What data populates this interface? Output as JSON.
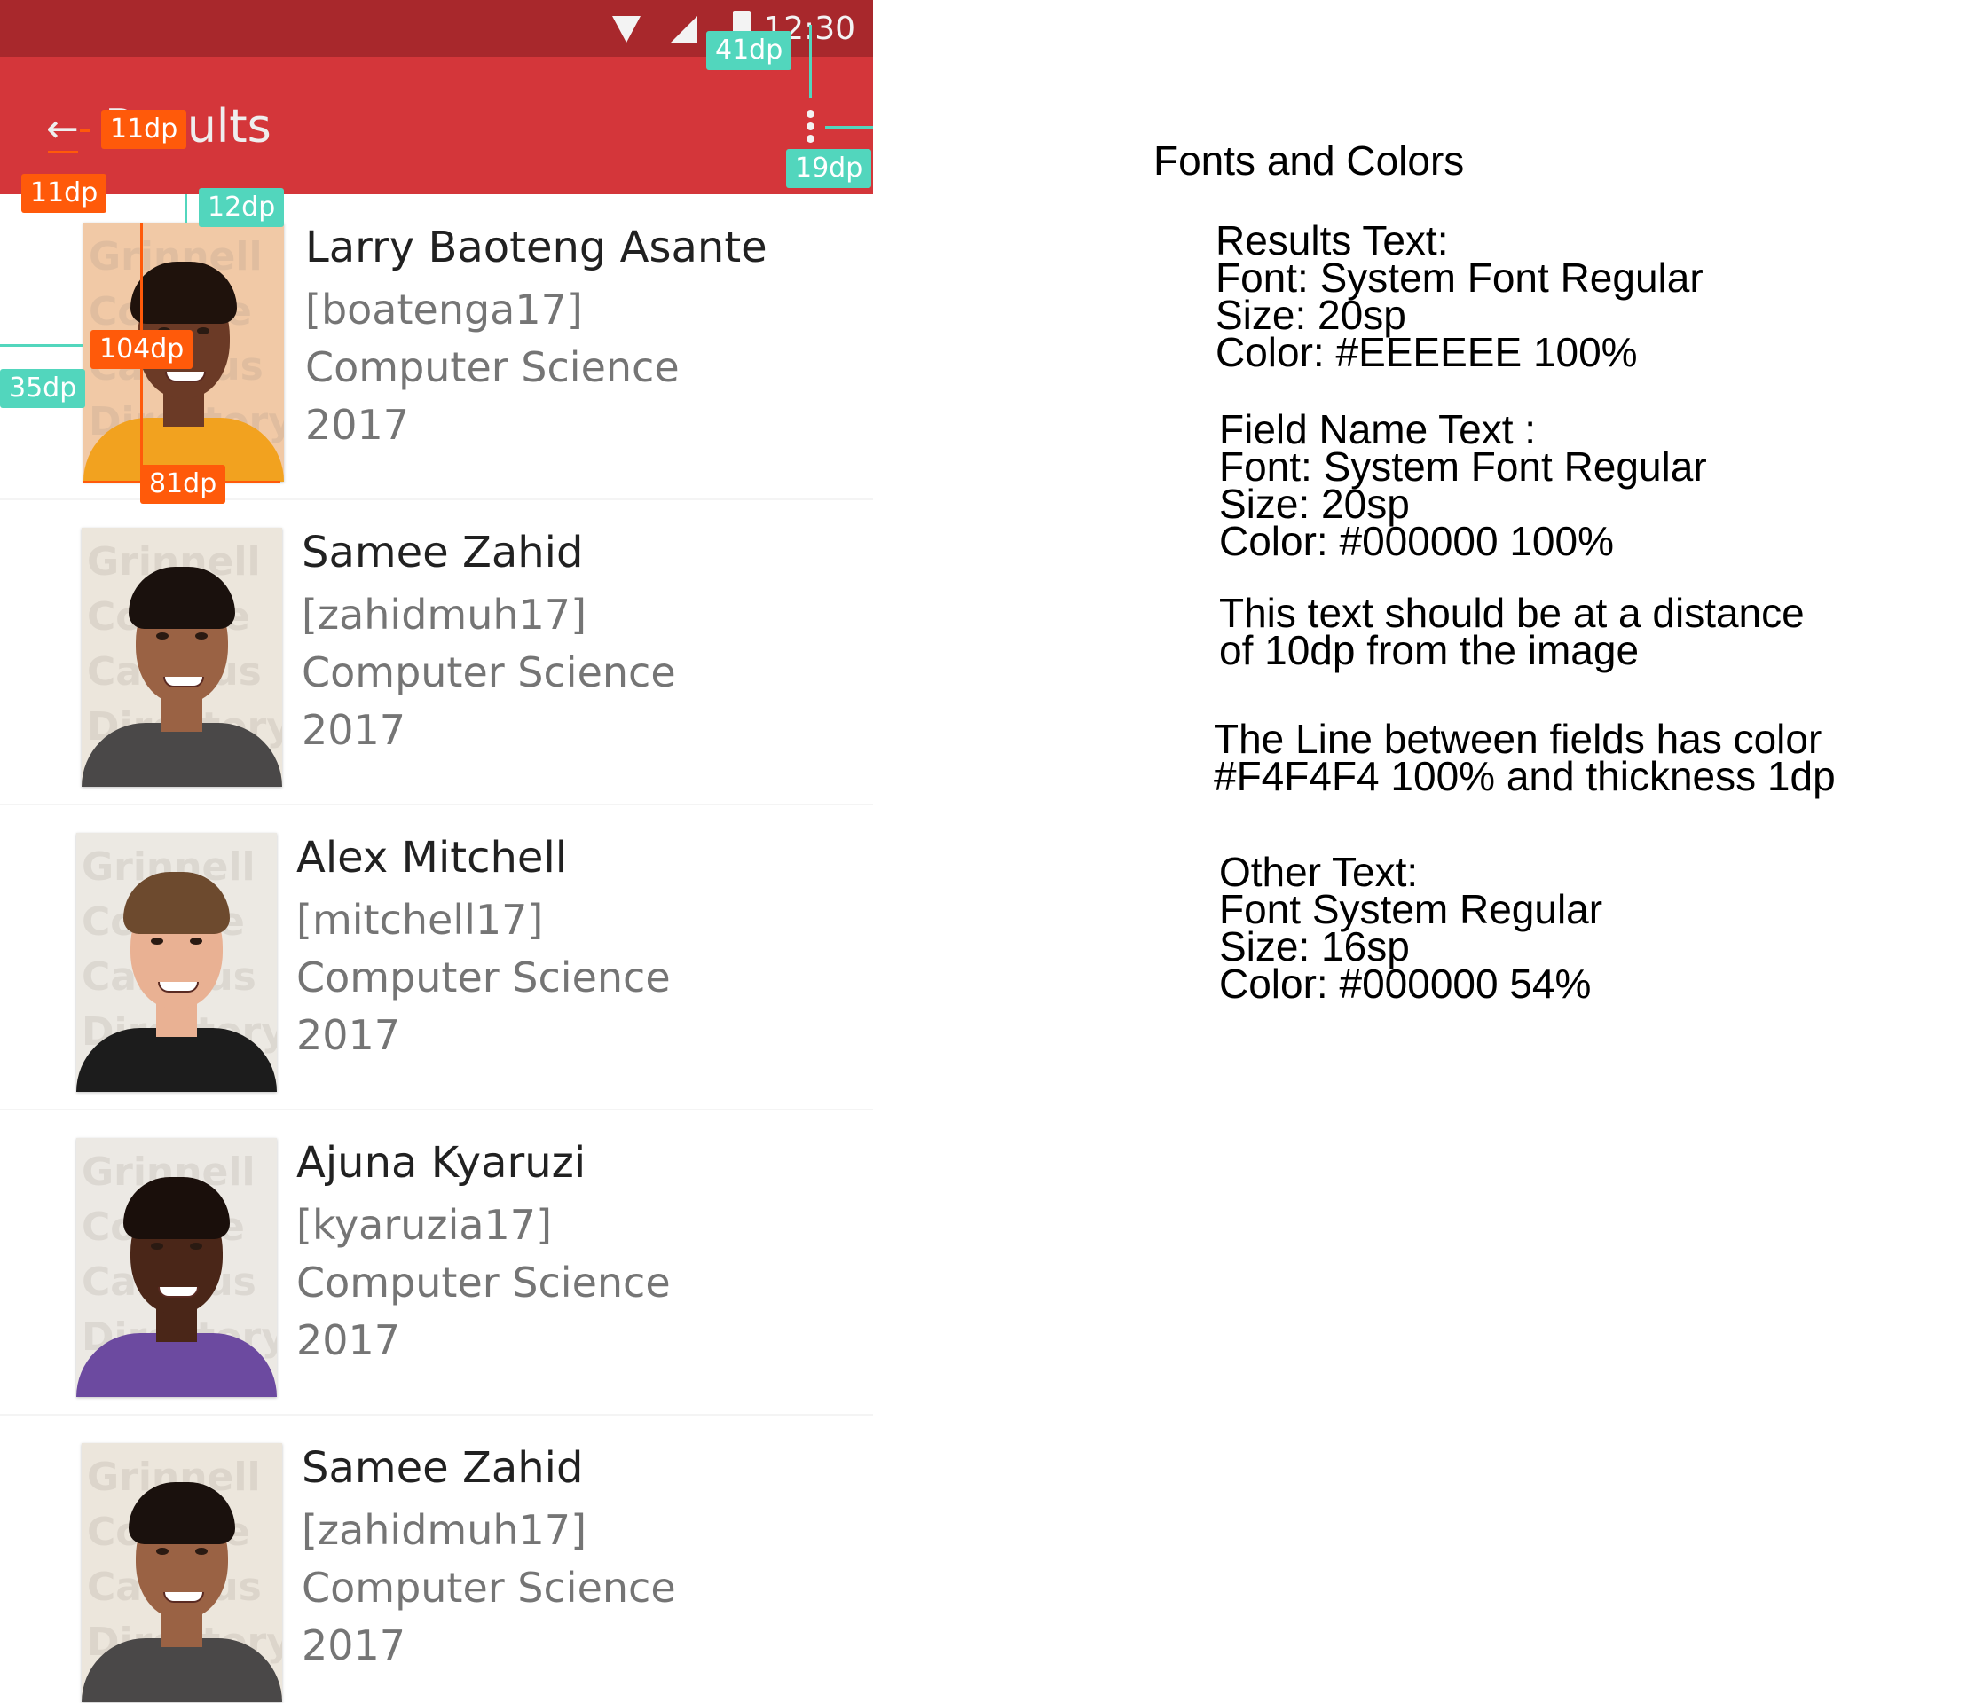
{
  "status_bar": {
    "time": "12:30"
  },
  "app_bar": {
    "back_icon": "arrow-left-icon",
    "title": "Results",
    "overflow_icon": "more-vert-icon"
  },
  "results": [
    {
      "name": "Larry Baoteng Asante",
      "username": "[boatenga17]",
      "major": "Computer Science",
      "year": "2017"
    },
    {
      "name": "Samee Zahid",
      "username": "[zahidmuh17]",
      "major": "Computer Science",
      "year": "2017"
    },
    {
      "name": "Alex Mitchell",
      "username": "[mitchell17]",
      "major": "Computer Science",
      "year": "2017"
    },
    {
      "name": "Ajuna Kyaruzi",
      "username": "[kyaruzia17]",
      "major": "Computer Science",
      "year": "2017"
    },
    {
      "name": "Samee Zahid",
      "username": "[zahidmuh17]",
      "major": "Computer Science",
      "year": "2017"
    }
  ],
  "photo_watermark": [
    "Grinnell",
    "College",
    "Campus",
    "Directory"
  ],
  "annotations": {
    "status_height": "41dp",
    "overflow_margin": "19dp",
    "back_to_title": "11dp",
    "back_left": "11dp",
    "photo_top": "12dp",
    "photo_height": "104dp",
    "photo_left": "35dp",
    "photo_width": "81dp"
  },
  "spec": {
    "heading": "Fonts and Colors",
    "results_text": [
      "Results Text:",
      "Font: System Font Regular",
      "Size: 20sp",
      "Color: #EEEEEE 100%"
    ],
    "field_name_text": [
      "Field Name Text :",
      "Font: System Font Regular",
      "Size: 20sp",
      "Color: #000000 100%"
    ],
    "distance_note": [
      "This text should be at a distance",
      "of 10dp from the image"
    ],
    "line_note": [
      "The Line between fields has color",
      "#F4F4F4 100% and thickness 1dp"
    ],
    "other_text": [
      "Other Text:",
      "Font System Regular",
      "Size: 16sp",
      "Color: #000000 54%"
    ]
  },
  "colors": {
    "status_bar": "#a8282c",
    "app_bar": "#d4363a",
    "divider": "#F4F4F4",
    "annotation_orange": "#ff5a0a",
    "annotation_teal": "#52d6bd"
  }
}
